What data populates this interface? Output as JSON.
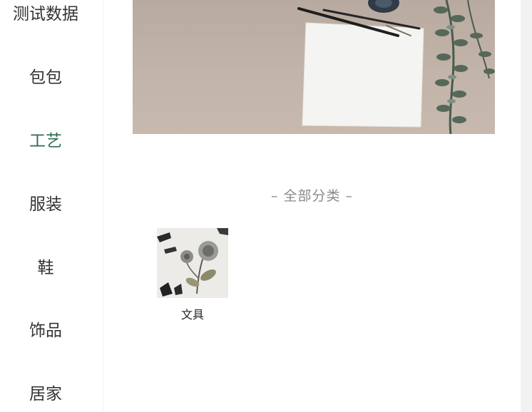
{
  "sidebar": {
    "items": [
      {
        "label": "测试数据",
        "active": false
      },
      {
        "label": "包包",
        "active": false
      },
      {
        "label": "工艺",
        "active": true
      },
      {
        "label": "服装",
        "active": false
      },
      {
        "label": "鞋",
        "active": false
      },
      {
        "label": "饰品",
        "active": false
      },
      {
        "label": "居家",
        "active": false
      }
    ]
  },
  "main": {
    "section_title": "– 全部分类 –",
    "categories": [
      {
        "label": "文具",
        "image_icon": "stationery-flower-thumbnail"
      }
    ]
  },
  "colors": {
    "active_category": "#2e6b4f",
    "text": "#333333",
    "muted": "#8a8a8a",
    "banner_bg": "#c2b4a8"
  }
}
